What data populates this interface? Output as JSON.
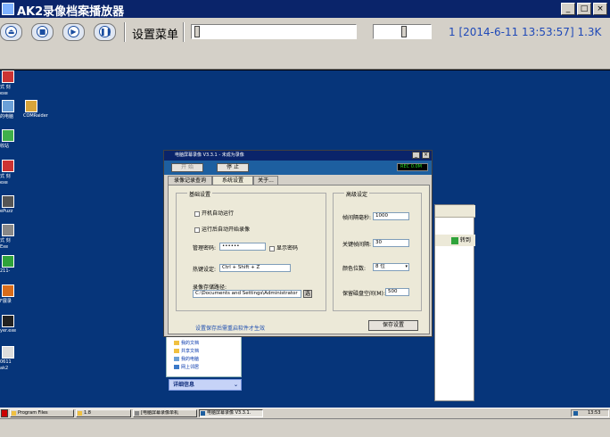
{
  "player": {
    "title": "AK2录像档案播放器",
    "title_buttons": [
      "_",
      "□",
      "×"
    ],
    "controls": [
      {
        "name": "rewind-icon",
        "glyph": "⏏"
      },
      {
        "name": "stop-icon",
        "glyph": "■"
      },
      {
        "name": "play-icon",
        "glyph": "▶"
      },
      {
        "name": "pause-icon",
        "glyph": "❚❚"
      }
    ],
    "settings_menu": "设置菜单",
    "status_text": "1 [2014-6-11 13:53:57]  1.3K",
    "accent_color": "#0a246a"
  },
  "desktop": {
    "icons": [
      {
        "label": "式 刻",
        "sub": "exe"
      },
      {
        "label": "的电脑",
        "sub": ""
      },
      {
        "label": "COMRaider",
        "sub": ""
      },
      {
        "label": "收站",
        "sub": ""
      },
      {
        "label": "式 刻",
        "sub": "exe"
      },
      {
        "label": "ePuzz",
        "sub": ""
      },
      {
        "label": "式 刻",
        "sub": "Exe"
      },
      {
        "label": "211-",
        "sub": ""
      },
      {
        "label": "F展录",
        "sub": ""
      },
      {
        "label": "yer.exe",
        "sub": ""
      },
      {
        "label": "0611",
        "sub": "ak2"
      }
    ]
  },
  "explorer": {
    "go_label": "转到",
    "lower_items": [
      "我的文档",
      "共享文档",
      "我的电脑",
      "网上邻居"
    ],
    "detail_label": "详细信息"
  },
  "recorder": {
    "title": "电脑屏幕录像 V3.3.1 - 未成为录像",
    "start_label": "开 始",
    "stop_label": "停 止",
    "rec_indicator": "REC 0.0M",
    "tabs": [
      "录像记录查询",
      "系统设置",
      "关于..."
    ],
    "basic": {
      "caption": "基础设置",
      "autostart": "开机自动运行",
      "autorecord": "运行后自动开始录像",
      "password_label": "管理密码:",
      "password_value": "••••••",
      "show_password": "显示密码",
      "hotkey_label": "热键设定:",
      "hotkey_value": "Ctrl + Shift + Z",
      "path_label": "录像存储路径:",
      "path_value": "C:\\Documents and Settings\\Administrator",
      "browse": "选"
    },
    "advanced": {
      "caption": "高级设定",
      "interval_label": "帧间隔毫秒:",
      "interval_value": "1000",
      "keyframe_label": "关键帧间隔:",
      "keyframe_value": "30",
      "color_label": "颜色位数:",
      "color_value": "8 位",
      "reserve_label": "保留磁盘空间(M):",
      "reserve_value": "500"
    },
    "note": "设置保存后需重启软件才生效",
    "save_button": "保存设置"
  },
  "taskbar": {
    "tasks": [
      "Program Files",
      "1.8",
      "[电脑屏幕录像单机",
      "电脑屏幕录像 V3.3.1."
    ],
    "clock": "13:53"
  }
}
